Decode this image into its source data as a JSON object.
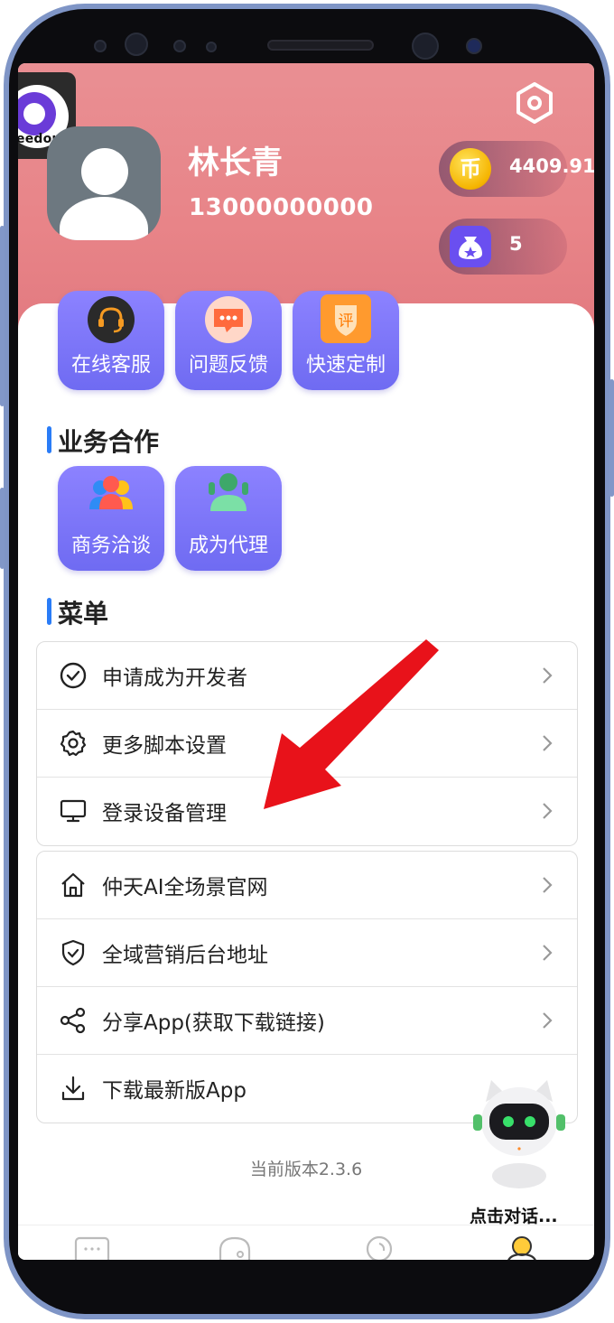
{
  "profile": {
    "name": "林长青",
    "phone": "13000000000",
    "coins": "4409.91",
    "coin_glyph": "币",
    "bag_count": "5"
  },
  "logo": {
    "text": "eedom"
  },
  "quick_tiles": [
    {
      "label": "在线客服",
      "icon": "headset-icon"
    },
    {
      "label": "问题反馈",
      "icon": "chat-bubble-icon"
    },
    {
      "label": "快速定制",
      "icon": "review-badge-icon",
      "badge": "评"
    }
  ],
  "business": {
    "title": "业务合作",
    "tiles": [
      {
        "label": "商务洽谈",
        "icon": "people-group-icon"
      },
      {
        "label": "成为代理",
        "icon": "agent-icon"
      }
    ]
  },
  "menu": {
    "title": "菜单",
    "group1": [
      {
        "label": "申请成为开发者",
        "icon": "check-circle-icon"
      },
      {
        "label": "更多脚本设置",
        "icon": "gear-icon"
      },
      {
        "label": "登录设备管理",
        "icon": "monitor-icon"
      }
    ],
    "group2": [
      {
        "label": "仲天AI全场景官网",
        "icon": "home-icon"
      },
      {
        "label": "全域营销后台地址",
        "icon": "shield-check-icon"
      },
      {
        "label": "分享App(获取下载链接)",
        "icon": "share-icon"
      },
      {
        "label": "下载最新版App",
        "icon": "download-icon"
      }
    ]
  },
  "version": "当前版本2.3.6",
  "assistant": {
    "label": "点击对话..."
  },
  "tabs": [
    "message-icon",
    "ghost-icon",
    "bulb-icon",
    "profile-icon"
  ],
  "colors": {
    "header": "#e88488",
    "tile": "#7a74f7",
    "accent": "#2a7cf7",
    "arrow": "#e8121a"
  }
}
